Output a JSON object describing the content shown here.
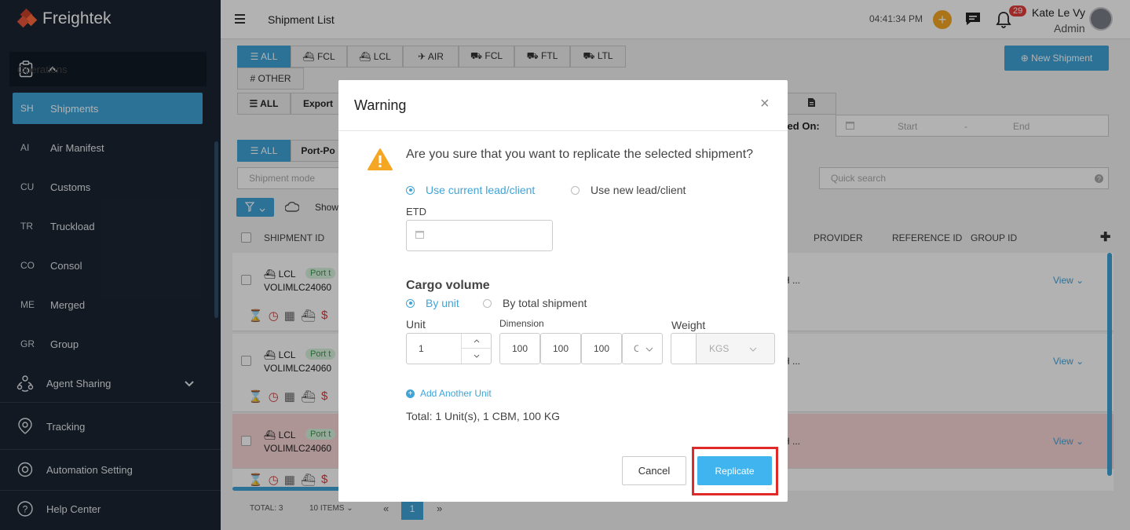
{
  "app": {
    "name": "Freightek"
  },
  "sidebar": {
    "section": "Operations",
    "items": [
      {
        "abbr": "SH",
        "label": "Shipments"
      },
      {
        "abbr": "AI",
        "label": "Air Manifest"
      },
      {
        "abbr": "CU",
        "label": "Customs"
      },
      {
        "abbr": "TR",
        "label": "Truckload"
      },
      {
        "abbr": "CO",
        "label": "Consol"
      },
      {
        "abbr": "ME",
        "label": "Merged"
      },
      {
        "abbr": "GR",
        "label": "Group"
      }
    ],
    "agent_sharing": "Agent Sharing",
    "tracking": "Tracking",
    "automation": "Automation Setting",
    "help": "Help Center"
  },
  "header": {
    "title": "Shipment List",
    "time": "04:41:34 PM",
    "plus": "+",
    "notif_count": "29",
    "user_name": "Kate Le Vy",
    "user_role": "Admin"
  },
  "mode_tabs": [
    "☰ ALL",
    "⛴ FCL",
    "⛴ LCL",
    "✈ AIR",
    "⛟ FCL",
    "⛟ FTL",
    "⛟ LTL",
    "# OTHER"
  ],
  "new_shipment": "⊕ New Shipment",
  "filter_tabs": {
    "all": "☰ ALL",
    "export": "Export",
    "all2": "☰ ALL",
    "portpo": "Port-Po"
  },
  "created_on": {
    "label": "ated On:",
    "start": "Start",
    "sep": "-",
    "end": "End"
  },
  "search": {
    "mode_placeholder": "Shipment mode",
    "quick_placeholder": "Quick search",
    "show": "Show"
  },
  "table": {
    "headers": {
      "shipment_id": "SHIPMENT ID",
      "provider": "PROVIDER",
      "reference_id": "REFERENCE ID",
      "group_id": "GROUP ID"
    },
    "rows": [
      {
        "mode": "LCL",
        "status": "Port t",
        "id": "VOLIMLC24060",
        "provider": "H ...",
        "view": "View"
      },
      {
        "mode": "LCL",
        "status": "Port t",
        "id": "VOLIMLC24060",
        "provider": "H ...",
        "view": "View"
      },
      {
        "mode": "LCL",
        "status": "Port t",
        "id": "VOLIMLC24060",
        "provider": "H ...",
        "view": "View"
      }
    ]
  },
  "footer": {
    "total": "TOTAL: 3",
    "items": "10 ITEMS",
    "prev": "«",
    "page": "1",
    "next": "»"
  },
  "dialog": {
    "title": "Warning",
    "close": "×",
    "question": "Are you sure that you want to replicate the selected shipment?",
    "opt_current": "Use current lead/client",
    "opt_new": "Use new lead/client",
    "etd_label": "ETD",
    "cargo_title": "Cargo volume",
    "opt_by_unit": "By unit",
    "opt_by_total": "By total shipment",
    "unit_label": "Unit",
    "dimension_label": "Dimension",
    "weight_label": "Weight",
    "unit_value": "1",
    "dim_l": "100",
    "dim_w": "100",
    "dim_h": "100",
    "dim_unit": "C",
    "weight_unit": "KGS",
    "add_unit": "Add Another Unit",
    "total": "Total: 1 Unit(s), 1 CBM, 100 KG",
    "cancel": "Cancel",
    "replicate": "Replicate"
  }
}
